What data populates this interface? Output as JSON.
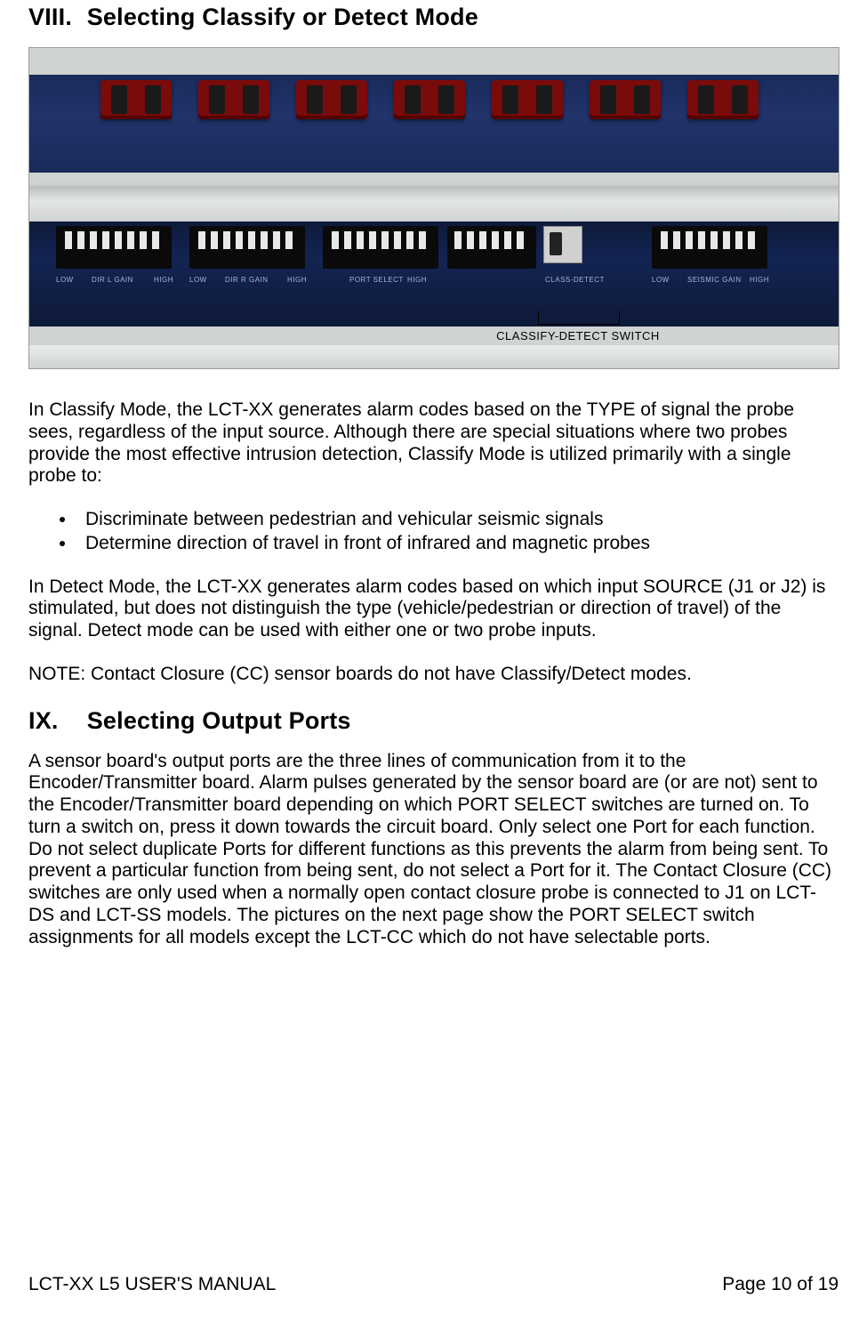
{
  "section8": {
    "number": "VIII.",
    "title": "Selecting Classify or Detect Mode",
    "figure_label": "CLASSIFY-DETECT SWITCH",
    "para1": "In Classify Mode, the LCT-XX generates alarm codes based on the TYPE of signal the probe sees, regardless of the input source.  Although there are special situations where two probes provide the most effective intrusion detection, Classify Mode is utilized primarily with a single probe to:",
    "bullets": [
      "Discriminate between pedestrian and vehicular seismic signals",
      "Determine direction of travel in front of infrared and magnetic probes"
    ],
    "para2": "In Detect Mode, the LCT-XX generates alarm codes based on which input SOURCE (J1 or J2) is stimulated, but does not distinguish the type (vehicle/pedestrian or direction of travel) of the signal.  Detect mode can be used with either one or two probe inputs.",
    "note": "NOTE:  Contact Closure (CC) sensor boards do not have Classify/Detect modes."
  },
  "section9": {
    "number": "IX.",
    "title": "Selecting Output Ports",
    "para1": "A sensor board's output ports are the three lines of communication from it to the Encoder/Transmitter board.  Alarm pulses generated by the sensor board are (or are not) sent to the Encoder/Transmitter board depending on which PORT SELECT switches are turned on.  To turn a switch on, press it down towards the circuit board.  Only select one Port for each function.  Do not select duplicate Ports for different functions as this prevents the alarm from being sent.  To prevent a particular function from being sent, do not select a Port for it.  The Contact Closure (CC) switches are only used when a normally open contact closure probe is connected to J1 on LCT-DS and LCT-SS models.  The pictures on the next page show the PORT SELECT switch assignments for all models except the LCT-CC which do not have selectable ports."
  },
  "footer": {
    "left": "LCT-XX L5 USER'S MANUAL",
    "right": "Page 10 of 19"
  },
  "board_silk": {
    "s1": "DIR L GAIN",
    "s2": "DIR R GAIN",
    "s3": "PORT SELECT",
    "s4": "CLASS-DETECT",
    "s5": "SEISMIC GAIN",
    "low": "LOW",
    "high": "HIGH"
  }
}
